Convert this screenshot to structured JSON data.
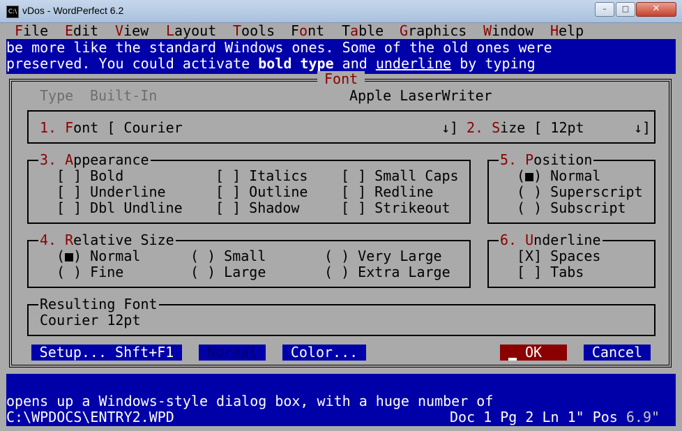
{
  "window": {
    "title": "vDos - WordPerfect 6.2",
    "icon_label": "C:\\",
    "minimize": "–",
    "maximize": "□",
    "close": "✕"
  },
  "menu": [
    {
      "hotkey": "F",
      "rest": "ile"
    },
    {
      "hotkey": "E",
      "rest": "dit"
    },
    {
      "hotkey": "V",
      "rest": "iew"
    },
    {
      "hotkey": "L",
      "rest": "ayout"
    },
    {
      "hotkey": "T",
      "rest": "ools"
    },
    {
      "pre": "F",
      "hotkey": "o",
      "rest": "nt"
    },
    {
      "pre": "T",
      "hotkey": "a",
      "rest": "ble"
    },
    {
      "hotkey": "G",
      "rest": "raphics"
    },
    {
      "hotkey": "W",
      "rest": "indow"
    },
    {
      "hotkey": "H",
      "rest": "elp"
    }
  ],
  "doc_text": {
    "line1": "be more like the standard Windows ones. Some of the old ones were",
    "line2_a": "preserved. You could activate ",
    "line2_bold": "bold type",
    "line2_b": " and ",
    "line2_underline": "underline",
    "line2_c": " by typing",
    "line3": "opens up a Windows-style dialog box, with a huge number of"
  },
  "dialog": {
    "title": "Font",
    "type_label": "Type",
    "type_value": "Built-In",
    "printer": "Apple LaserWriter",
    "font_field": {
      "num": "1. ",
      "hotkey": "F",
      "rest": "ont [ Courier",
      "arrow": "↓]"
    },
    "size_field": {
      "num": "2. ",
      "hotkey": "S",
      "rest": "ize [ 12pt",
      "arrow": "↓]"
    },
    "appearance": {
      "legend_num": "3. ",
      "legend_hotkey": "A",
      "legend_rest": "ppearance",
      "options": [
        {
          "box": "[ ]",
          "label": "Bold"
        },
        {
          "box": "[ ]",
          "label": "Underline"
        },
        {
          "box": "[ ]",
          "label": "Dbl Undline"
        },
        {
          "box": "[ ]",
          "label": "Italics"
        },
        {
          "box": "[ ]",
          "label": "Outline"
        },
        {
          "box": "[ ]",
          "label": "Shadow"
        },
        {
          "box": "[ ]",
          "label": "Small Caps"
        },
        {
          "box": "[ ]",
          "label": "Redline"
        },
        {
          "box": "[ ]",
          "label": "Strikeout"
        }
      ]
    },
    "position": {
      "legend_num": "5. ",
      "legend_hotkey": "P",
      "legend_rest": "osition",
      "options": [
        {
          "box": "(■)",
          "label": "Normal"
        },
        {
          "box": "( )",
          "label": "Superscript"
        },
        {
          "box": "( )",
          "label": "Subscript"
        }
      ]
    },
    "relative_size": {
      "legend_num": "4. ",
      "legend_hotkey": "R",
      "legend_rest": "elative Size",
      "options": [
        {
          "box": "(■)",
          "label": "Normal"
        },
        {
          "box": "( )",
          "label": "Fine"
        },
        {
          "box": "( )",
          "label": "Small"
        },
        {
          "box": "( )",
          "label": "Large"
        },
        {
          "box": "( )",
          "label": "Very Large"
        },
        {
          "box": "( )",
          "label": "Extra Large"
        }
      ]
    },
    "underline": {
      "legend_num": "6. ",
      "legend_hotkey": "U",
      "legend_rest": "nderline",
      "options": [
        {
          "box": "[X]",
          "label": "Spaces"
        },
        {
          "box": "[ ]",
          "label": "Tabs"
        }
      ]
    },
    "resulting": {
      "legend": "Resulting Font",
      "value": "Courier 12pt"
    },
    "buttons": {
      "setup": "Setup... Shft+F1",
      "normal": "Normal",
      "color": "Color...",
      "ok": "OK",
      "cancel": "Cancel"
    }
  },
  "status": {
    "path": "C:\\WPDOCS\\ENTRY2.WPD",
    "doc_label": "Doc 1 Pg 2 Ln 1\" Pos ",
    "pos_value": "6.9\""
  },
  "colors": {
    "console_bg": "#0000a8",
    "dialog_bg": "#aaaaaa",
    "hotkey": "#8b0000",
    "ok_bg": "#8b0000"
  }
}
